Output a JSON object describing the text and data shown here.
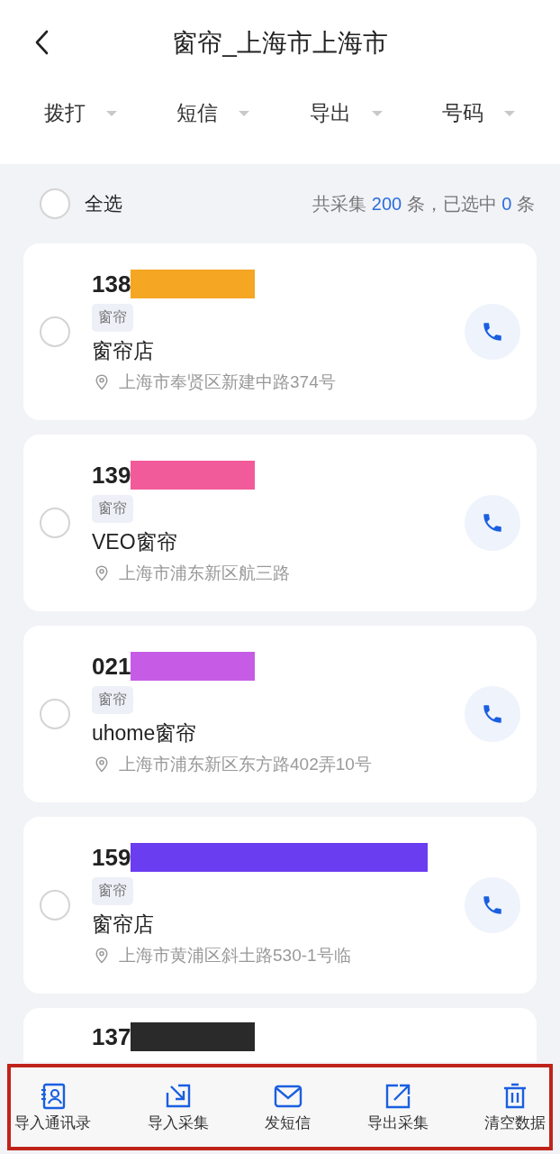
{
  "header": {
    "title": "窗帘_上海市上海市"
  },
  "filters": [
    {
      "label": "拨打"
    },
    {
      "label": "短信"
    },
    {
      "label": "导出"
    },
    {
      "label": "号码"
    }
  ],
  "select_all": {
    "label": "全选",
    "checked": false,
    "summary": "共采集 **200** 条，已选中 **0** 条"
  },
  "contacts": [
    {
      "phone": "138",
      "color": "#f5a623",
      "checked": false,
      "tag": "窗帘",
      "name": "窗帘店",
      "address": "上海市奉贤区新建中路374号"
    },
    {
      "phone": "139",
      "color": "#f25b9a",
      "checked": false,
      "tag": "窗帘",
      "name": "VEO窗帘",
      "address": "上海市浦东新区航三路"
    },
    {
      "phone": "021",
      "color": "#c65ce6",
      "checked": false,
      "tag": "窗帘",
      "name": "uhome窗帘",
      "address": "上海市浦东新区东方路402弄10号"
    },
    {
      "phone": "159",
      "color": "#6a3df0",
      "checked": false,
      "tag": "窗帘",
      "name": "窗帘店",
      "address": "上海市黄浦区斜土路530-1号临"
    },
    {
      "phone": "137",
      "color": "#2a2a2a"
    }
  ],
  "toolbar": [
    {
      "kind": "contacts",
      "label": "导入通讯录"
    },
    {
      "kind": "import",
      "label": "导入采集"
    },
    {
      "kind": "mail",
      "label": "发短信"
    },
    {
      "kind": "export",
      "label": "导出采集"
    },
    {
      "kind": "trash",
      "label": "清空数据"
    }
  ]
}
